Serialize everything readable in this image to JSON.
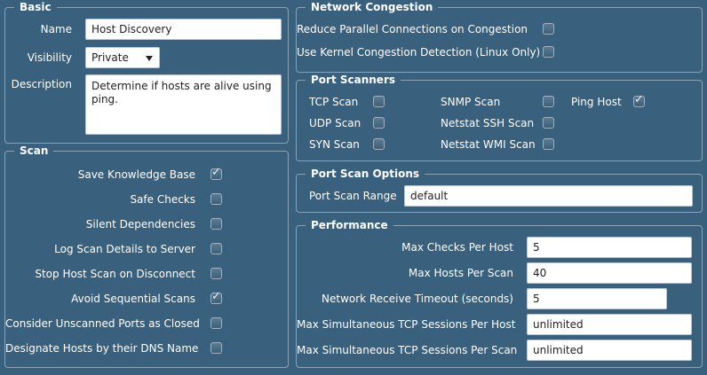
{
  "basic": {
    "legend": "Basic",
    "name_label": "Name",
    "name_value": "Host Discovery",
    "visibility_label": "Visibility",
    "visibility_value": "Private",
    "description_label": "Description",
    "description_value": "Determine if hosts are alive using ping."
  },
  "scan": {
    "legend": "Scan",
    "items": [
      {
        "label": "Save Knowledge Base",
        "checked": true
      },
      {
        "label": "Safe Checks",
        "checked": false
      },
      {
        "label": "Silent Dependencies",
        "checked": false
      },
      {
        "label": "Log Scan Details to Server",
        "checked": false
      },
      {
        "label": "Stop Host Scan on Disconnect",
        "checked": false
      },
      {
        "label": "Avoid Sequential Scans",
        "checked": true
      },
      {
        "label": "Consider Unscanned Ports as Closed",
        "checked": false
      },
      {
        "label": "Designate Hosts by their DNS Name",
        "checked": false
      }
    ]
  },
  "network_congestion": {
    "legend": "Network Congestion",
    "items": [
      {
        "label": "Reduce Parallel Connections on Congestion",
        "checked": false
      },
      {
        "label": "Use Kernel Congestion Detection (Linux Only)",
        "checked": false
      }
    ]
  },
  "port_scanners": {
    "legend": "Port Scanners",
    "items": [
      {
        "label": "TCP Scan",
        "checked": false
      },
      {
        "label": "UDP Scan",
        "checked": false
      },
      {
        "label": "SYN Scan",
        "checked": false
      },
      {
        "label": "SNMP Scan",
        "checked": false
      },
      {
        "label": "Netstat SSH Scan",
        "checked": false
      },
      {
        "label": "Netstat WMI Scan",
        "checked": false
      },
      {
        "label": "Ping Host",
        "checked": true
      }
    ]
  },
  "port_scan_options": {
    "legend": "Port Scan Options",
    "range_label": "Port Scan Range",
    "range_value": "default"
  },
  "performance": {
    "legend": "Performance",
    "items": [
      {
        "label": "Max Checks Per Host",
        "value": "5"
      },
      {
        "label": "Max Hosts Per Scan",
        "value": "40"
      },
      {
        "label": "Network Receive Timeout (seconds)",
        "value": "5"
      },
      {
        "label": "Max Simultaneous TCP Sessions Per Host",
        "value": "unlimited"
      },
      {
        "label": "Max Simultaneous TCP Sessions Per Scan",
        "value": "unlimited"
      }
    ]
  },
  "icons": {
    "checkmark": "checkmark-icon",
    "dropdown": "chevron-down-icon"
  }
}
